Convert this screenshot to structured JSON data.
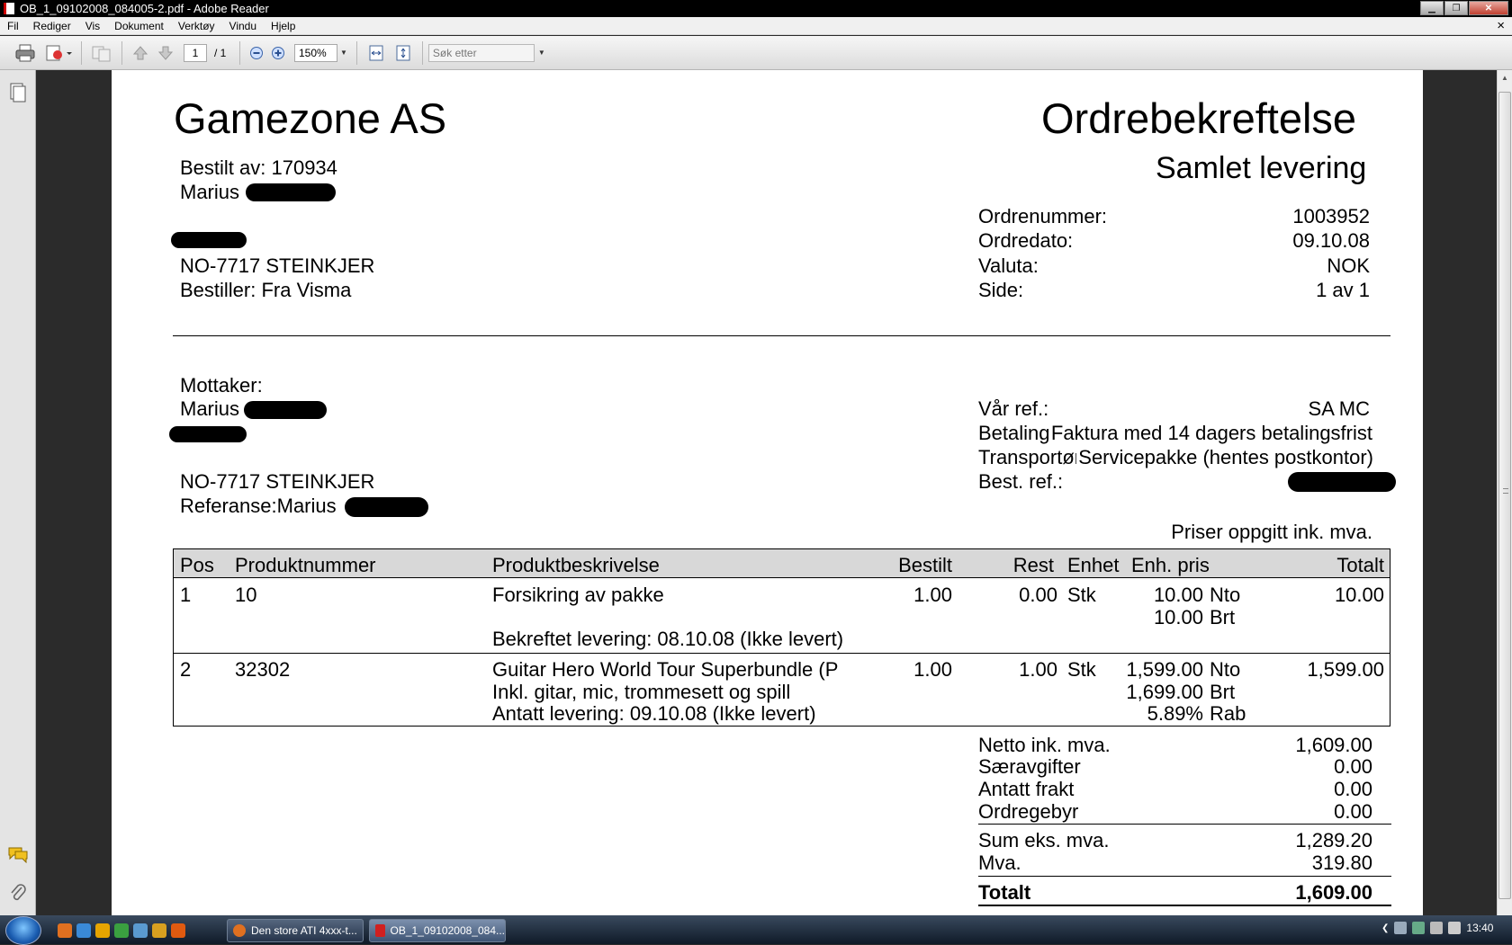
{
  "window": {
    "title": "OB_1_09102008_084005-2.pdf - Adobe Reader",
    "minimize": "▁",
    "maximize": "❐",
    "close": "✕"
  },
  "menu": {
    "items": [
      "Fil",
      "Rediger",
      "Vis",
      "Dokument",
      "Verktøy",
      "Vindu",
      "Hjelp"
    ],
    "close_doc": "×"
  },
  "toolbar": {
    "page_current": "1",
    "page_total": "/ 1",
    "zoom": "150%",
    "search_placeholder": "Søk etter"
  },
  "document": {
    "company": "Gamezone AS",
    "doc_title": "Ordrebekreftelse",
    "doc_subtitle": "Samlet levering",
    "ordered_by": "Bestilt av: 170934",
    "buyer_first": "Marius",
    "buyer_postal": "NO-7717 STEINKJER",
    "orderer": "Bestiller: Fra Visma",
    "meta_labels": [
      "Ordrenummer:",
      "Ordredato:",
      "Valuta:",
      "Side:"
    ],
    "meta_values": [
      "1003952",
      "09.10.08",
      "NOK",
      "1 av 1"
    ],
    "recipient_label": "Mottaker:",
    "recipient_first": "Marius",
    "recipient_postal": "NO-7717 STEINKJER",
    "reference": "Referanse:Marius",
    "our_ref_label": "Vår ref.:",
    "our_ref_value": "SA MC",
    "payment_label": "Betaling",
    "payment_value": "Faktura med 14 dagers betalingsfrist",
    "transport_label": "Transportør",
    "transport_value": "Servicepakke (hentes postkontor)",
    "best_ref_label": "Best. ref.:",
    "prices_note": "Priser oppgitt ink. mva.",
    "table_headers": [
      "Pos",
      "Produktnummer",
      "Produktbeskrivelse",
      "Bestilt",
      "Rest",
      "Enhet",
      "Enh. pris",
      "Totalt"
    ],
    "lines": [
      {
        "pos": "1",
        "product_no": "10",
        "desc": "Forsikring av pakke",
        "desc2": "",
        "delivery": "Bekreftet levering: 08.10.08 (Ikke levert)",
        "ordered": "1.00",
        "rest": "0.00",
        "unit": "Stk",
        "price_nto": "10.00",
        "nto": "Nto",
        "price_brt": "10.00",
        "brt": "Brt",
        "discount": "",
        "rab": "",
        "total": "10.00"
      },
      {
        "pos": "2",
        "product_no": "32302",
        "desc": "Guitar Hero World Tour Superbundle (P",
        "desc2": "Inkl. gitar, mic, trommesett og spill",
        "delivery": "Antatt levering: 09.10.08 (Ikke levert)",
        "ordered": "1.00",
        "rest": "1.00",
        "unit": "Stk",
        "price_nto": "1,599.00",
        "nto": "Nto",
        "price_brt": "1,699.00",
        "brt": "Brt",
        "discount": "5.89%",
        "rab": "Rab",
        "total": "1,599.00"
      }
    ],
    "summary": [
      {
        "label": "Netto ink. mva.",
        "value": "1,609.00"
      },
      {
        "label": "Særavgifter",
        "value": "0.00"
      },
      {
        "label": "Antatt frakt",
        "value": "0.00"
      },
      {
        "label": "Ordregebyr",
        "value": "0.00"
      },
      {
        "label": "Sum eks. mva.",
        "value": "1,289.20"
      },
      {
        "label": "Mva.",
        "value": "319.80"
      }
    ],
    "total_label": "Totalt",
    "total_value": "1,609.00"
  },
  "taskbar": {
    "tasks": [
      "Den store ATI 4xxx-t...",
      "OB_1_09102008_084..."
    ],
    "clock": "13:40"
  },
  "colors": {
    "titlebar": "#000000",
    "viewer_bg": "#2b2b2b",
    "paper": "#ffffff",
    "table_header": "#d8d8d8"
  }
}
